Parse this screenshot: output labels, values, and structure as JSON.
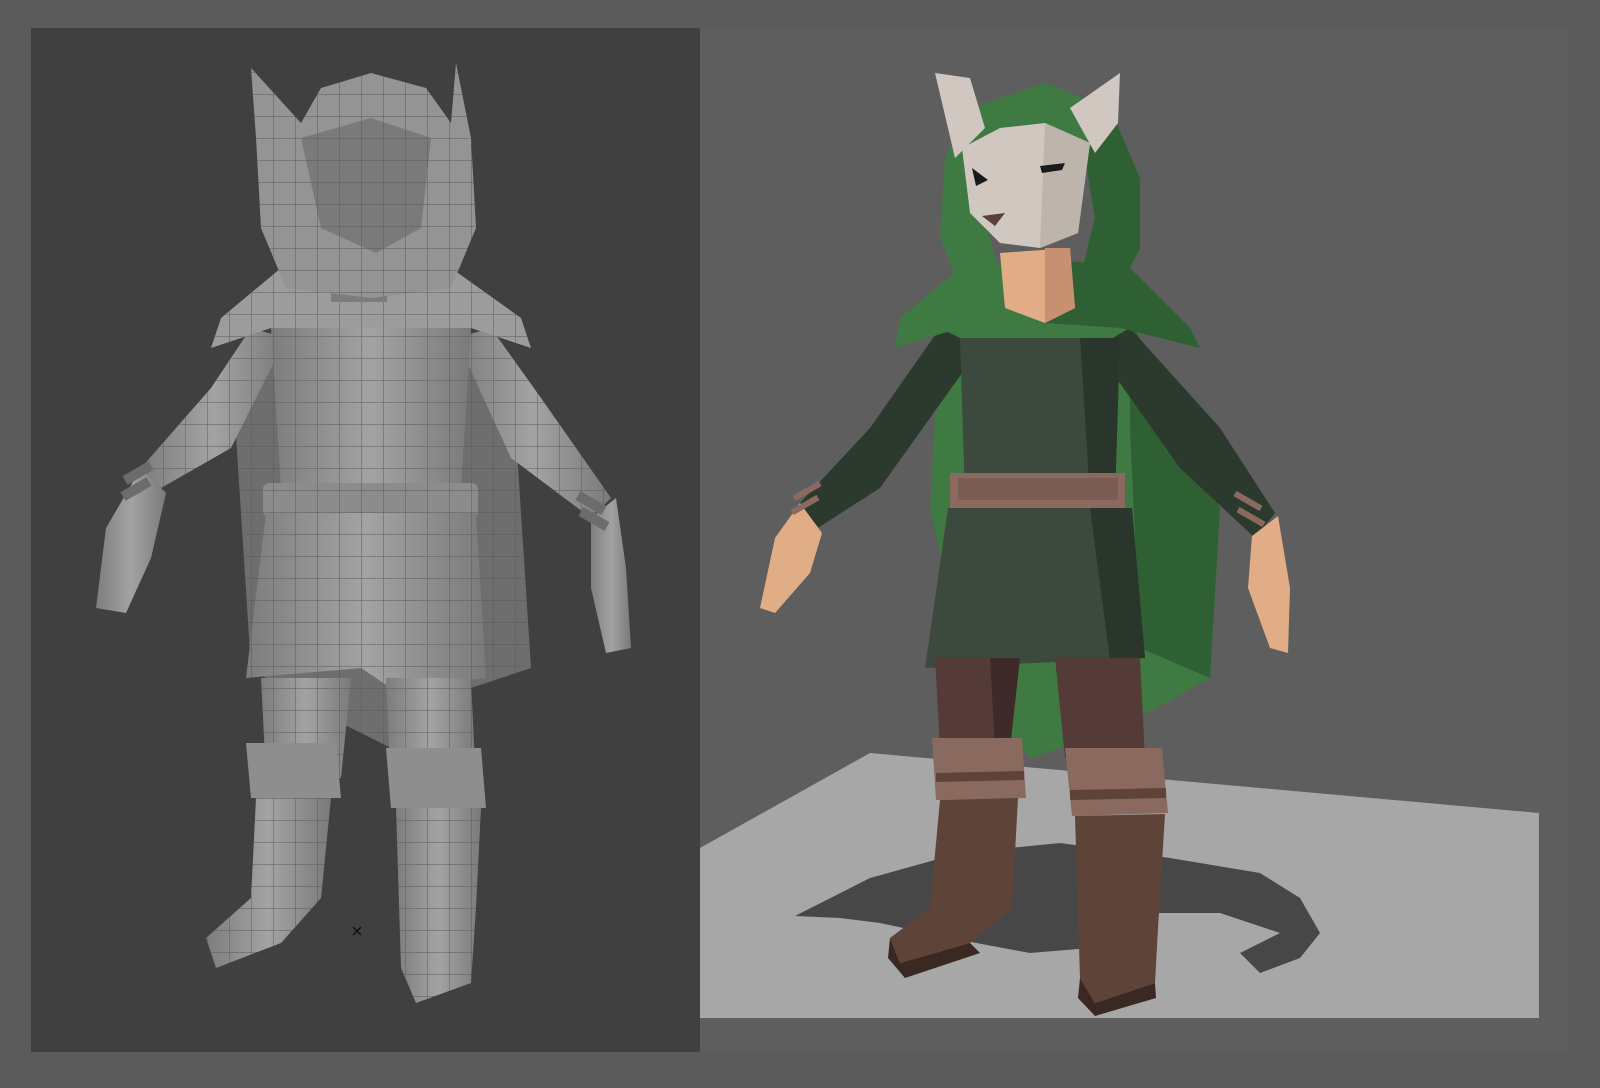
{
  "views": {
    "left": {
      "mode": "wireframe-clay",
      "background": "#404040",
      "model_color": "#8f8f8f",
      "wire_color": "#555555"
    },
    "right": {
      "mode": "flat-shaded-color",
      "background": "#5e5e5e",
      "floor_color": "#a7a7a7",
      "shadow_color": "#474747"
    }
  },
  "character": {
    "palette": {
      "hood": "#3f7a43",
      "hood_dark": "#2c5c31",
      "tunic": "#3c4a3d",
      "tunic_dark": "#2a362b",
      "belt": "#8a6a5e",
      "pants": "#553b38",
      "boots": "#5e4338",
      "boot_cuff": "#8a6a5e",
      "skin": "#e1ad87",
      "mask": "#cfc7c0",
      "mask_nose": "#5a3e3a"
    }
  }
}
